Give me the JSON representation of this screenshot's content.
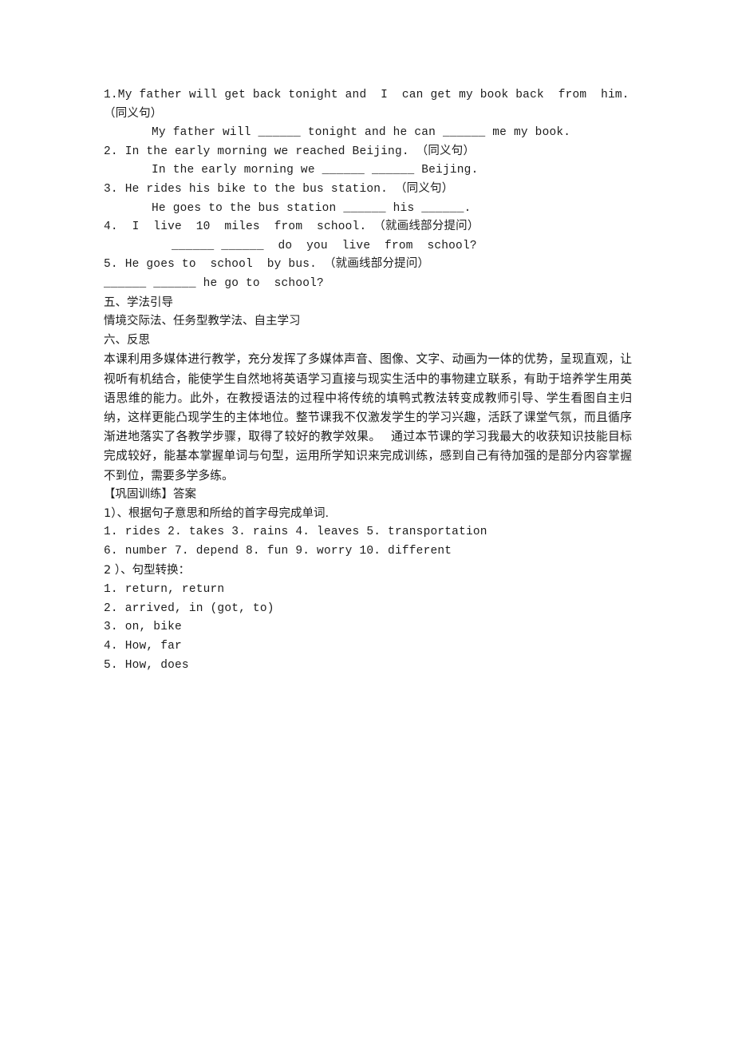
{
  "document": {
    "background_color": "#ffffff",
    "text_color": "#1c1c1c"
  },
  "exercises": {
    "items": [
      {
        "prompt": "1.My father will get back tonight and  I  can get my book back  from  him. （同义句）",
        "answer_blank": "My father will ______ tonight and he can ______ me my book."
      },
      {
        "prompt": "2. In the early morning we reached Beijing. （同义句）",
        "answer_blank": "In the early morning we ______ ______ Beijing."
      },
      {
        "prompt": "3. He rides his bike to the bus station. （同义句）",
        "answer_blank": "He goes to the bus station ______ his ______."
      },
      {
        "prompt": "4.  I  live  10  miles  from  school. （就画线部分提问）",
        "answer_blank": "______ ______  do  you  live  from  school?"
      },
      {
        "prompt": "5. He goes to  school  by bus. （就画线部分提问）",
        "answer_blank": "______ ______ he go to  school?"
      }
    ]
  },
  "section_five": {
    "heading": "五、学法引导",
    "body": "情境交际法、任务型教学法、自主学习"
  },
  "section_six": {
    "heading": "六、反思",
    "reflection": "本课利用多媒体进行教学，充分发挥了多媒体声音、图像、文字、动画为一体的优势，呈现直观，让视听有机结合，能使学生自然地将英语学习直接与现实生活中的事物建立联系，有助于培养学生用英语思维的能力。此外，在教授语法的过程中将传统的填鸭式教法转变成教师引导、学生看图自主归纳，这样更能凸现学生的主体地位。整节课我不仅激发学生的学习兴趣，活跃了课堂气氛，而且循序渐进地落实了各教学步骤，取得了较好的教学效果。　 通过本节课的学习我最大的收获知识技能目标完成较好，能基本掌握单词与句型，运用所学知识来完成训练，感到自己有待加强的是部分内容掌握不到位，需要多学多练。"
  },
  "answer_key": {
    "title": "【巩固训练】答案",
    "part1_heading": "1）、根据句子意思和所给的首字母完成单词.",
    "part1_lines": [
      "1. rides 2. takes 3. rains 4. leaves 5. transportation",
      "6. number 7. depend 8. fun 9. worry 10. different"
    ],
    "part2_heading": "2 ）、句型转换：",
    "part2_lines": [
      "1. return, return",
      "2. arrived, in (got, to)",
      "3. on, bike",
      "4. How, far",
      "5. How, does"
    ]
  }
}
